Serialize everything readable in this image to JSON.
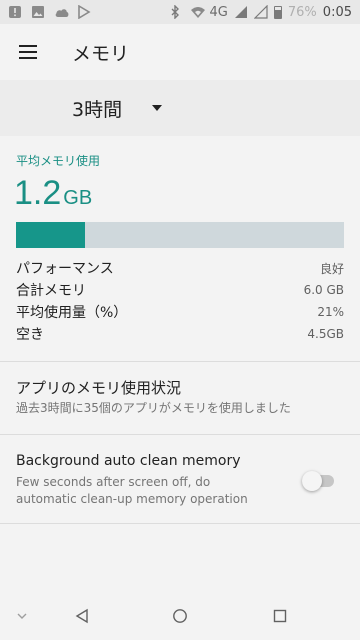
{
  "status_bar": {
    "network": "4G",
    "battery": "76%",
    "time": "0:05",
    "icons_left": [
      "alert-icon",
      "image-icon",
      "cloud-icon",
      "play-store-icon"
    ],
    "icons_right": [
      "bluetooth-icon",
      "wifi-icon",
      "signal-icon",
      "signal-empty-icon",
      "battery-icon"
    ]
  },
  "app_bar": {
    "title": "メモリ",
    "menu_icon": "menu-icon"
  },
  "period": {
    "selected": "3時間"
  },
  "summary": {
    "avg_label": "平均メモリ使用",
    "avg_value": "1.2",
    "avg_unit": "GB",
    "usage_fraction": 0.21,
    "stats": [
      {
        "label": "パフォーマンス",
        "value": "良好"
      },
      {
        "label": "合計メモリ",
        "value": "6.0 GB"
      },
      {
        "label": "平均使用量（%）",
        "value": "21%"
      },
      {
        "label": "空き",
        "value": "4.5GB"
      }
    ]
  },
  "app_usage": {
    "title": "アプリのメモリ使用状況",
    "subtitle": "過去3時間に35個のアプリがメモリを使用しました"
  },
  "auto_clean": {
    "title": "Background auto clean memory",
    "subtitle_line1": "Few seconds after screen off, do",
    "subtitle_line2": "automatic clean-up memory operation",
    "enabled": false
  },
  "nav_bar": {
    "icons": [
      "chevron-down-icon",
      "back-icon",
      "home-icon",
      "recents-icon"
    ]
  },
  "colors": {
    "accent": "#1a8f84",
    "bar_fill": "#16968a",
    "bar_track": "#cfd8dc"
  }
}
